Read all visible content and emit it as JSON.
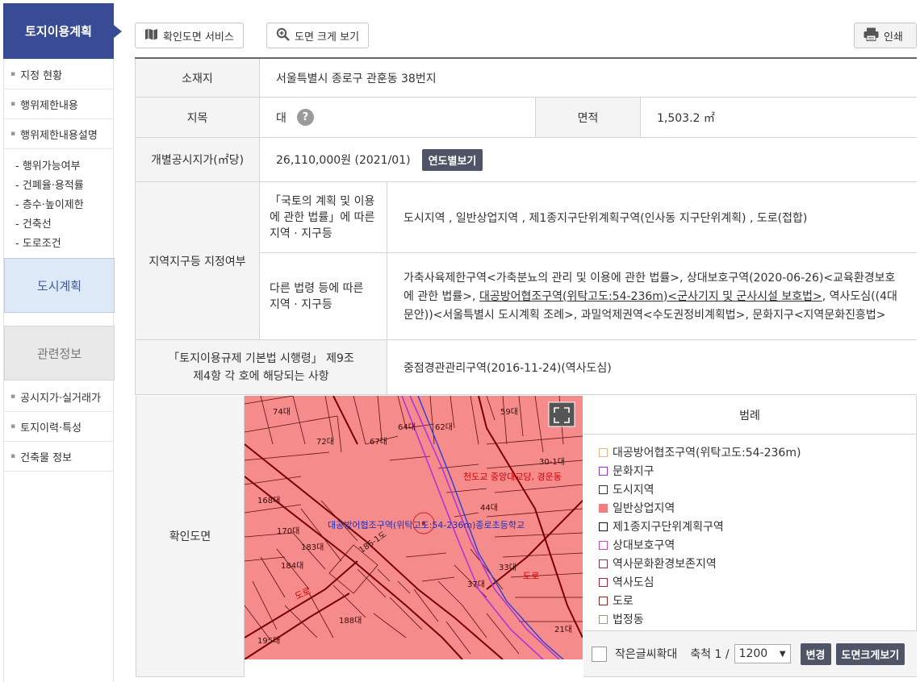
{
  "sidebar": {
    "title": "토지이용계획",
    "items": [
      {
        "label": "지정 현황"
      },
      {
        "label": "행위제한내용"
      },
      {
        "label": "행위제한내용설명"
      }
    ],
    "subitems": [
      {
        "label": "- 행위가능여부"
      },
      {
        "label": "- 건폐율·용적률"
      },
      {
        "label": "- 층수·높이제한"
      },
      {
        "label": "- 건축선"
      },
      {
        "label": "- 도로조건"
      }
    ],
    "city_plan": "도시계획",
    "related": "관련정보",
    "related_items": [
      {
        "label": "공시지가·실거래가"
      },
      {
        "label": "토지이력·특성"
      },
      {
        "label": "건축물 정보"
      }
    ]
  },
  "toolbar": {
    "confirm_map_service": "확인도면 서비스",
    "large_view": "도면 크게 보기",
    "print": "인쇄"
  },
  "info": {
    "location_label": "소재지",
    "location_value": "서울특별시 종로구 관훈동 38번지",
    "jimok_label": "지목",
    "jimok_value": "대",
    "help_glyph": "?",
    "area_label": "면적",
    "area_value": "1,503.2 ㎡",
    "price_label": "개별공시지가(㎡당)",
    "price_value": "26,110,000원 (2021/01)",
    "price_year_button": "연도별보기",
    "zone_label": "지역지구등 지정여부",
    "zone_law1_label": "「국토의 계획 및 이용에 관한 법률」에 따른 지역 · 지구등",
    "zone_law1_value": "도시지역 , 일반상업지역 , 제1종지구단위계획구역(인사동 지구단위계획) , 도로(접합)",
    "zone_law2_label": "다른 법령 등에 따른 지역 · 지구등",
    "zone_law2_value_a": "가축사육제한구역<가축분뇨의 관리 및 이용에 관한 법률>, 상대보호구역(2020-06-26)<교육환경보호에 관한 법률>, ",
    "zone_law2_value_link": "대공방어협조구역(위탁고도:54-236m)<군사기지 및 군사시설 보호법>",
    "zone_law2_value_b": ", 역사도심((4대문안))<서울특별시 도시계획 조례>, 과밀억제권역<수도권정비계획법>, 문화지구<지역문화진흥법>",
    "basic_law_label": "「토지이용규제 기본법 시행령」 제9조 제4항 각 호에 해당되는 사항",
    "basic_law_value": "중점경관관리구역(2016-11-24)(역사도심)"
  },
  "map": {
    "label": "확인도면",
    "parcels": [
      {
        "name": "74대"
      },
      {
        "name": "72대"
      },
      {
        "name": "67대"
      },
      {
        "name": "64대"
      },
      {
        "name": "62대"
      },
      {
        "name": "59대"
      },
      {
        "name": "30-1대"
      },
      {
        "name": "168대"
      },
      {
        "name": "170대"
      },
      {
        "name": "183대"
      },
      {
        "name": "184대"
      },
      {
        "name": "44대"
      },
      {
        "name": "33대"
      },
      {
        "name": "37대"
      },
      {
        "name": "188대"
      },
      {
        "name": "195대"
      },
      {
        "name": "21대"
      },
      {
        "name": "186-1도"
      }
    ],
    "labels": {
      "zone_red": "천도교 중앙대교당, 경운동",
      "zone_blue": "대공방어협조구역(위탁고도:54-236m)종로초등학교",
      "road1": "도로",
      "road2": "도로"
    }
  },
  "legend": {
    "title": "범례",
    "items": [
      {
        "label": "대공방어협조구역(위탁고도:54-236m)",
        "color": "#e8b48a",
        "fill": "#ffffff"
      },
      {
        "label": "문화지구",
        "color": "#9933cc",
        "fill": "#ffffff"
      },
      {
        "label": "도시지역",
        "color": "#333333",
        "fill": "#ffffff"
      },
      {
        "label": "일반상업지역",
        "color": "#f08080",
        "fill": "#f08080"
      },
      {
        "label": "제1종지구단위계획구역",
        "color": "#111111",
        "fill": "#ffffff"
      },
      {
        "label": "상대보호구역",
        "color": "#cc44cc",
        "fill": "#ffffff"
      },
      {
        "label": "역사문화환경보존지역",
        "color": "#883344",
        "fill": "#ffffff"
      },
      {
        "label": "역사도심",
        "color": "#aa2233",
        "fill": "#ffffff"
      },
      {
        "label": "도로",
        "color": "#992222",
        "fill": "#ffffff"
      },
      {
        "label": "법정동",
        "color": "#999988",
        "fill": "#ffffff"
      }
    ]
  },
  "controls": {
    "small_text_zoom": "작은글씨확대",
    "scale_label": "축척 1 /",
    "scale_value": "1200",
    "change_button": "변경",
    "large_map_button": "도면크게보기"
  }
}
